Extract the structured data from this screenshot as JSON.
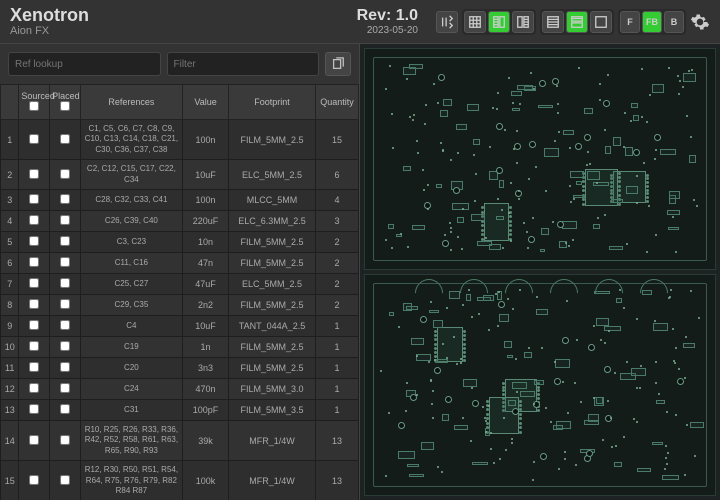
{
  "header": {
    "title": "Xenotron",
    "subtitle": "Aion FX",
    "rev_label": "Rev: 1.0",
    "date": "2023-05-20"
  },
  "layer_buttons": {
    "front": "F",
    "front_back": "FB",
    "back": "B"
  },
  "filters": {
    "ref_placeholder": "Ref lookup",
    "filter_placeholder": "Filter"
  },
  "columns": {
    "n": "",
    "sourced": "Sourced",
    "placed": "Placed",
    "refs": "References",
    "value": "Value",
    "footprint": "Footprint",
    "qty": "Quantity"
  },
  "rows": [
    {
      "n": "1",
      "refs": "C1, C5, C6, C7, C8, C9, C10, C13, C14, C18, C21, C30, C36, C37, C38",
      "value": "100n",
      "fp": "FILM_5MM_2.5",
      "q": "15"
    },
    {
      "n": "2",
      "refs": "C2, C12, C15, C17, C22, C34",
      "value": "10uF",
      "fp": "ELC_5MM_2.5",
      "q": "6"
    },
    {
      "n": "3",
      "refs": "C28, C32, C33, C41",
      "value": "100n",
      "fp": "MLCC_5MM",
      "q": "4"
    },
    {
      "n": "4",
      "refs": "C26, C39, C40",
      "value": "220uF",
      "fp": "ELC_6.3MM_2.5",
      "q": "3"
    },
    {
      "n": "5",
      "refs": "C3, C23",
      "value": "10n",
      "fp": "FILM_5MM_2.5",
      "q": "2"
    },
    {
      "n": "6",
      "refs": "C11, C16",
      "value": "47n",
      "fp": "FILM_5MM_2.5",
      "q": "2"
    },
    {
      "n": "7",
      "refs": "C25, C27",
      "value": "47uF",
      "fp": "ELC_5MM_2.5",
      "q": "2"
    },
    {
      "n": "8",
      "refs": "C29, C35",
      "value": "2n2",
      "fp": "FILM_5MM_2.5",
      "q": "2"
    },
    {
      "n": "9",
      "refs": "C4",
      "value": "10uF",
      "fp": "TANT_044A_2.5",
      "q": "1"
    },
    {
      "n": "10",
      "refs": "C19",
      "value": "1n",
      "fp": "FILM_5MM_2.5",
      "q": "1"
    },
    {
      "n": "11",
      "refs": "C20",
      "value": "3n3",
      "fp": "FILM_5MM_2.5",
      "q": "1"
    },
    {
      "n": "12",
      "refs": "C24",
      "value": "470n",
      "fp": "FILM_5MM_3.0",
      "q": "1"
    },
    {
      "n": "13",
      "refs": "C31",
      "value": "100pF",
      "fp": "FILM_5MM_3.5",
      "q": "1"
    },
    {
      "n": "14",
      "refs": "R10, R25, R26, R33, R36, R42, R52, R58, R61, R63, R65, R90, R93",
      "value": "39k",
      "fp": "MFR_1/4W",
      "q": "13"
    },
    {
      "n": "15",
      "refs": "R12, R30, R50, R51, R54, R64, R75, R76, R79, R82  R84  R87",
      "value": "100k",
      "fp": "MFR_1/4W",
      "q": "13"
    }
  ]
}
